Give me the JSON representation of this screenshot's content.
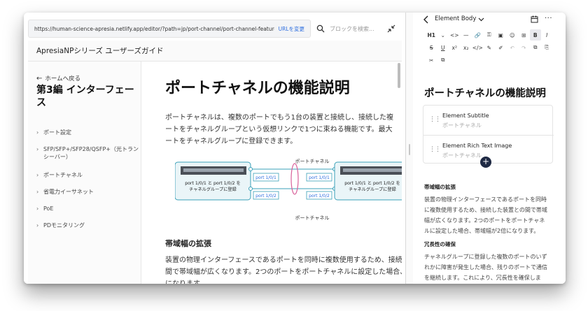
{
  "browser": {
    "url": "https://human-science-apresia.netlify.app/editor/?path=jp/port-channel/port-channel-feature-description",
    "change_url": "URLを変更",
    "search_placeholder": "ブロックを検索..."
  },
  "site": {
    "title": "ApresiaNPシリーズ ユーザーズガイド"
  },
  "sidenav": {
    "back_home": "ホームへ戻る",
    "chapter_line1": "第3編 インターフェー",
    "chapter_line2": "ス",
    "items": [
      {
        "line1": "ポート設定",
        "line2": ""
      },
      {
        "line1": "SFP/SFP+/SFP28/QSFP+（光トラン",
        "line2": "シーバー）"
      },
      {
        "line1": "ポートチャネル",
        "line2": ""
      },
      {
        "line1": "省電力イーサネット",
        "line2": ""
      },
      {
        "line1": "PoE",
        "line2": ""
      },
      {
        "line1": "PDモニタリング",
        "line2": ""
      }
    ]
  },
  "article": {
    "title": "ポートチャネルの機能説明",
    "intro_lines": [
      "ポートチャネルは、複数のポートでもう1台の装置と接続し、接続した複",
      "ートをチャネルグループという仮想リンクで1つに束ねる機能です。最大",
      "ートをチャネルグループに登録できます。"
    ],
    "section_title": "帯域幅の拡張",
    "section_lines": [
      "装置の物理インターフェースであるポートを同時に複数使用するため、接続した",
      "間で帯域幅が広くなります。2つのポートをポートチャネルに設定した場合、帯域",
      "になります。"
    ],
    "diagram": {
      "top_label": "ポートチャネル",
      "bottom_label": "ポートチャネル",
      "left_device_line1": "port 1/0/1 と port 1/0/2 を",
      "left_device_line2": "チャネルグループに登録",
      "right_device_line1": "port 1/0/1 と port 1/0/2 を",
      "right_device_line2": "チャネルグループに登録",
      "port_a_left": "port 1/0/1",
      "port_b_left": "port 1/0/2",
      "port_a_right": "port 1/0/1",
      "port_b_right": "port 1/0/2"
    }
  },
  "editor": {
    "header_title": "Element Body",
    "more": "···",
    "toolbar_row1": [
      "H1",
      "⌄",
      "<>",
      "—",
      "🔗",
      "⚿",
      "▣",
      "☺",
      "⊞",
      "B",
      "I"
    ],
    "toolbar_row2": [
      "S",
      "U",
      "x²",
      "x₂",
      "</>",
      "✎",
      "✐",
      "↶",
      "↷",
      "⧉",
      "⎘"
    ],
    "toolbar_row3": [
      "✂",
      "⧉"
    ],
    "title": "ポートチャネルの機能説明",
    "blocks": [
      {
        "name": "Element Subtitle",
        "placeholder": "ポートチャネル"
      },
      {
        "name": "Element Rich Text Image",
        "placeholder": "ポートチャネル"
      }
    ],
    "add": "+",
    "rich_text": {
      "heading1": "帯域幅の拡張",
      "para1": [
        "装置の物理インターフェースであるポートを同時",
        "に複数使用するため、接続した装置との間で帯域",
        "幅が広くなります。2つのポートをポートチャネ",
        "ルに設定した場合、帯域幅が2倍になります。"
      ],
      "heading2": "冗長性の確保",
      "para2": [
        "チャネルグループに登録した複数のポートのいず",
        "れかに障害が発生した場合、残りのポートで通信",
        "を継続します。これにより、冗長性を確保しま",
        "す。"
      ]
    }
  },
  "colors": {
    "accent_blue": "#2f6fdf",
    "diagram_teal": "#3aa0b8",
    "diagram_pink": "#d9619a",
    "add_button": "#1f2a44"
  }
}
